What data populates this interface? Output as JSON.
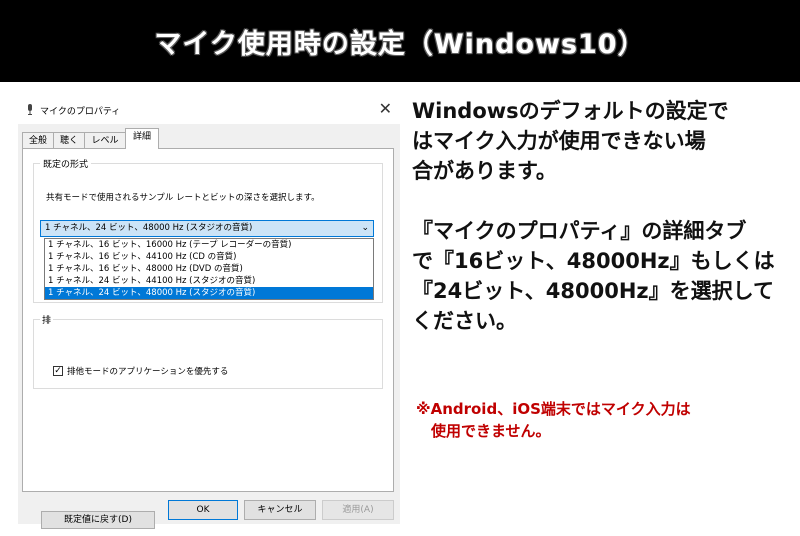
{
  "banner": {
    "title": "マイク使用時の設定（Windows10）"
  },
  "dialog": {
    "title": "マイクのプロパティ",
    "tabs": [
      {
        "label": "全般"
      },
      {
        "label": "聴く"
      },
      {
        "label": "レベル"
      },
      {
        "label": "詳細"
      }
    ],
    "default_format": {
      "legend": "既定の形式",
      "description": "共有モードで使用されるサンプル レートとビットの深さを選択します。",
      "selected": "1 チャネル、24 ビット、48000 Hz (スタジオの音質)",
      "options": [
        "1 チャネル、16 ビット、16000 Hz (テープ レコーダーの音質)",
        "1 チャネル、16 ビット、44100 Hz (CD の音質)",
        "1 チャネル、16 ビット、48000 Hz (DVD の音質)",
        "1 チャネル、24 ビット、44100 Hz (スタジオの音質)",
        "1 チャネル、24 ビット、48000 Hz (スタジオの音質)"
      ]
    },
    "exclusive": {
      "legend": "排",
      "checkbox_label": "排他モードのアプリケーションを優先する"
    },
    "buttons": {
      "restore_default": "既定値に戻す(D)",
      "ok": "OK",
      "cancel": "キャンセル",
      "apply": "適用(A)"
    }
  },
  "instructions": {
    "para1": [
      "Windowsのデフォルトの設定で",
      "はマイク入力が使用できない場",
      "合があります。"
    ],
    "para2": [
      "『マイクのプロパティ』の詳細タブ",
      "で『16ビット、48000Hz』もしくは",
      "『24ビット、48000Hz』を選択して",
      "ください。"
    ],
    "note": [
      "※Android、iOS端末ではマイク入力は",
      "使用できません。"
    ]
  },
  "colors": {
    "accent": "#0078d7",
    "note": "#c00000",
    "banner": "#000000"
  }
}
